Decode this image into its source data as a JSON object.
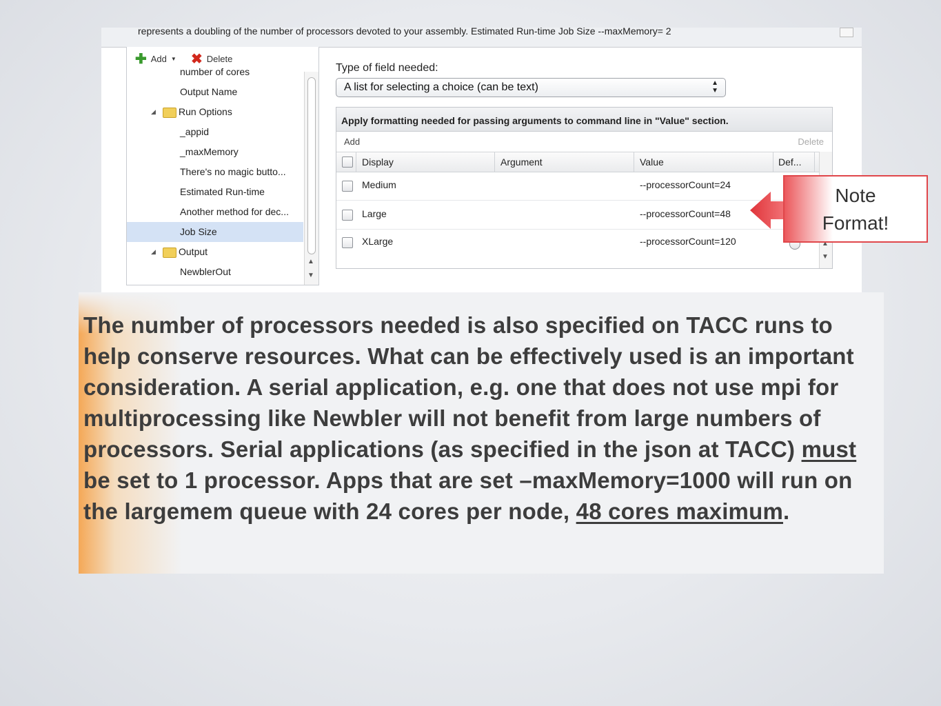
{
  "top_strip_text": "represents a doubling of the number of processors devoted to your assembly. Estimated Run-time Job Size --maxMemory= 2",
  "tree_toolbar": {
    "add_label": "Add",
    "delete_label": "Delete"
  },
  "tree": {
    "items": [
      {
        "label": "number of cores"
      },
      {
        "label": "Output Name"
      },
      {
        "label": "Run Options"
      },
      {
        "label": "_appid"
      },
      {
        "label": "_maxMemory"
      },
      {
        "label": "There's no magic butto..."
      },
      {
        "label": "Estimated Run-time"
      },
      {
        "label": "Another method for dec..."
      },
      {
        "label": "Job Size",
        "selected": true
      },
      {
        "label": "Output"
      },
      {
        "label": "NewblerOut"
      }
    ]
  },
  "editor": {
    "field_label": "Type of field needed:",
    "field_type_value": "A list for selecting a choice (can be text)",
    "grid_header": "Apply formatting needed for passing arguments to command line in \"Value\" section.",
    "add_label": "Add",
    "delete_label": "Delete",
    "columns": [
      "Display",
      "Argument",
      "Value",
      "Def..."
    ],
    "rows": [
      {
        "display": "Medium",
        "argument": "",
        "value": "--processorCount=24"
      },
      {
        "display": "Large",
        "argument": "",
        "value": "--processorCount=48"
      },
      {
        "display": "XLarge",
        "argument": "",
        "value": "--processorCount=120"
      }
    ]
  },
  "callout": {
    "line1": "Note",
    "line2": "Format!",
    "color": "#e0464a"
  },
  "body_text": {
    "part1": "The number of processors needed is also specified on TACC runs to help conserve resources. What can be effectively used is an important consideration. A serial application, e.g. one that does not use mpi for multiprocessing like Newbler will not benefit from large numbers of processors. Serial applications (as specified in the json at TACC) ",
    "must": "must",
    "part2": " be set to 1 processor. Apps that are set –maxMemory=1000 will run on the largemem queue with 24 cores per node, ",
    "max": "48 cores maximum",
    "part3": "."
  },
  "colors": {
    "accent": "#f5a046",
    "text": "#3d3d3d"
  }
}
